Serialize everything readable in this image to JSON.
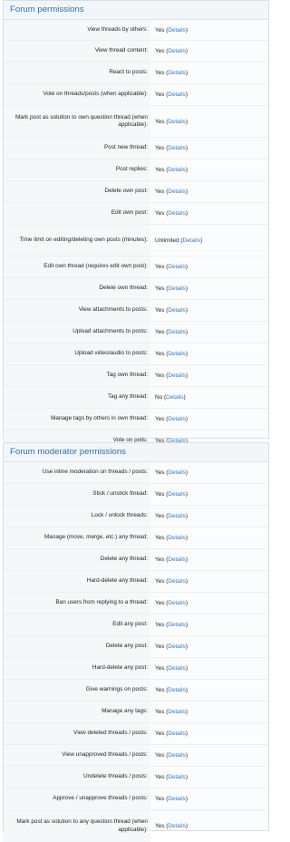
{
  "forum_permissions": {
    "title": "Forum permissions",
    "rows": [
      {
        "label": "View threads by others:",
        "value": "Yes",
        "link": "Details"
      },
      {
        "label": "View thread content:",
        "value": "Yes",
        "link": "Details"
      },
      {
        "label": "React to posts:",
        "value": "Yes",
        "link": "Details"
      },
      {
        "label": "Vote on threads/posts (when applicable):",
        "value": "Yes",
        "link": "Details"
      },
      {
        "label": "Mark post as solution to own question thread (when applicable):",
        "value": "Yes",
        "link": "Details"
      },
      {
        "label": "Post new thread:",
        "value": "Yes",
        "link": "Details"
      },
      {
        "label": "Post replies:",
        "value": "Yes",
        "link": "Details"
      },
      {
        "label": "Delete own post:",
        "value": "Yes",
        "link": "Details"
      },
      {
        "label": "Edit own post:",
        "value": "Yes",
        "link": "Details"
      },
      {
        "label": "Time limit on editing/deleting own posts (minutes):",
        "value": "Unlimited",
        "link": "Details"
      },
      {
        "label": "Edit own thread (requires edit own post):",
        "value": "Yes",
        "link": "Details"
      },
      {
        "label": "Delete own thread:",
        "value": "Yes",
        "link": "Details"
      },
      {
        "label": "View attachments to posts:",
        "value": "Yes",
        "link": "Details"
      },
      {
        "label": "Upload attachments to posts:",
        "value": "Yes",
        "link": "Details"
      },
      {
        "label": "Upload video/audio to posts:",
        "value": "Yes",
        "link": "Details"
      },
      {
        "label": "Tag own thread:",
        "value": "Yes",
        "link": "Details"
      },
      {
        "label": "Tag any thread:",
        "value": "No",
        "link": "Details"
      },
      {
        "label": "Manage tags by others in own thread:",
        "value": "Yes",
        "link": "Details"
      },
      {
        "label": "Vote on polls:",
        "value": "Yes",
        "link": "Details"
      }
    ]
  },
  "forum_moderator_permissions": {
    "title": "Forum moderator permissions",
    "rows": [
      {
        "label": "Use inline moderation on threads / posts:",
        "value": "Yes",
        "link": "Details"
      },
      {
        "label": "Stick / unstick thread:",
        "value": "Yes",
        "link": "Details"
      },
      {
        "label": "Lock / unlock threads:",
        "value": "Yes",
        "link": "Details"
      },
      {
        "label": "Manage (move, merge, etc.) any thread:",
        "value": "Yes",
        "link": "Details"
      },
      {
        "label": "Delete any thread:",
        "value": "Yes",
        "link": "Details"
      },
      {
        "label": "Hard-delete any thread:",
        "value": "Yes",
        "link": "Details"
      },
      {
        "label": "Ban users from replying to a thread:",
        "value": "Yes",
        "link": "Details"
      },
      {
        "label": "Edit any post:",
        "value": "Yes",
        "link": "Details"
      },
      {
        "label": "Delete any post:",
        "value": "Yes",
        "link": "Details"
      },
      {
        "label": "Hard-delete any post:",
        "value": "Yes",
        "link": "Details"
      },
      {
        "label": "Give warnings on posts:",
        "value": "Yes",
        "link": "Details"
      },
      {
        "label": "Manage any tags:",
        "value": "Yes",
        "link": "Details"
      },
      {
        "label": "View deleted threads / posts:",
        "value": "Yes",
        "link": "Details"
      },
      {
        "label": "View unapproved threads / posts:",
        "value": "Yes",
        "link": "Details"
      },
      {
        "label": "Undelete threads / posts:",
        "value": "Yes",
        "link": "Details"
      },
      {
        "label": "Approve / unapprove threads / posts:",
        "value": "Yes",
        "link": "Details"
      },
      {
        "label": "Mark post as solution to any question thread (when applicable):",
        "value": "Yes",
        "link": "Details"
      }
    ]
  },
  "colors": {
    "heading": "#2d6eae",
    "link": "#3a79bc",
    "border": "#d8dee5"
  }
}
